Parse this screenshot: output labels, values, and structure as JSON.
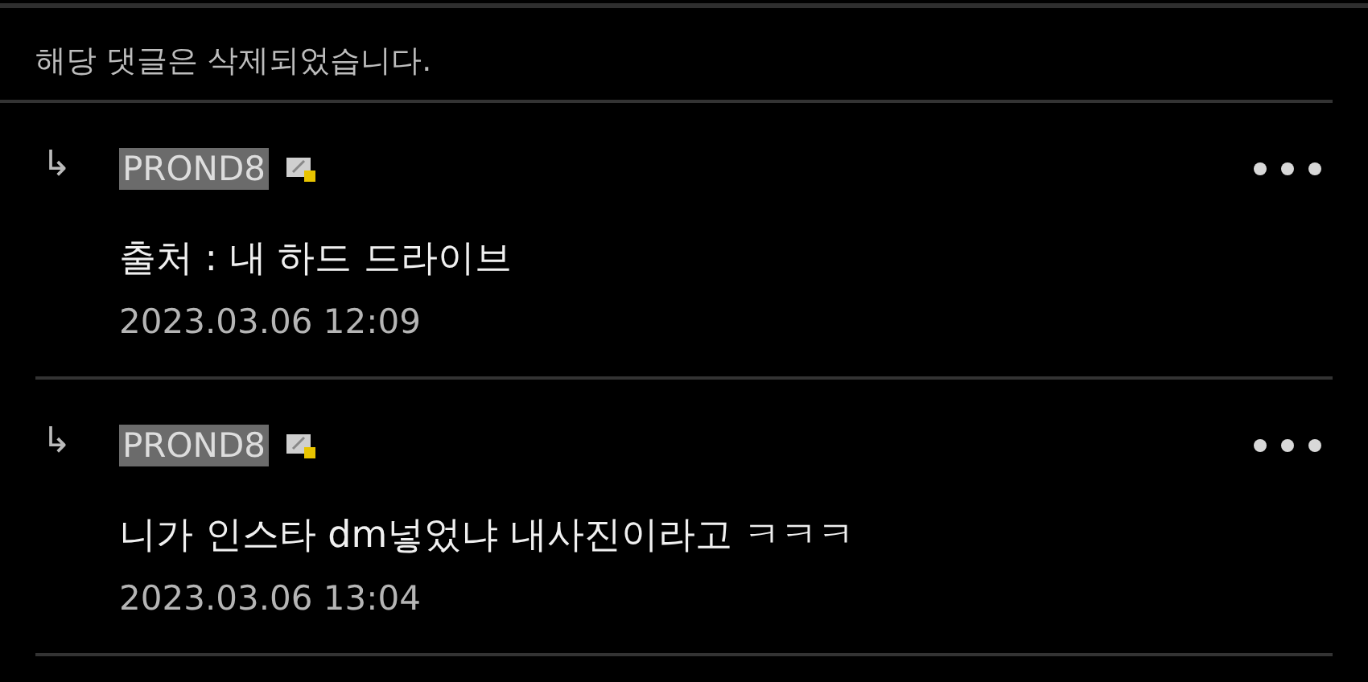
{
  "deleted_notice": "해당 댓글은 삭제되었습니다.",
  "replies": [
    {
      "arrow": "↳",
      "username": "PROND8",
      "highlighted": true,
      "body": "출처 : 내 하드 드라이브",
      "date": "2023.03.06 12:09"
    },
    {
      "arrow": "↳",
      "username": "PROND8",
      "highlighted": true,
      "body": "니가 인스타 dm넣었냐 내사진이라고 ㅋㅋㅋ",
      "date": "2023.03.06 13:04"
    }
  ]
}
